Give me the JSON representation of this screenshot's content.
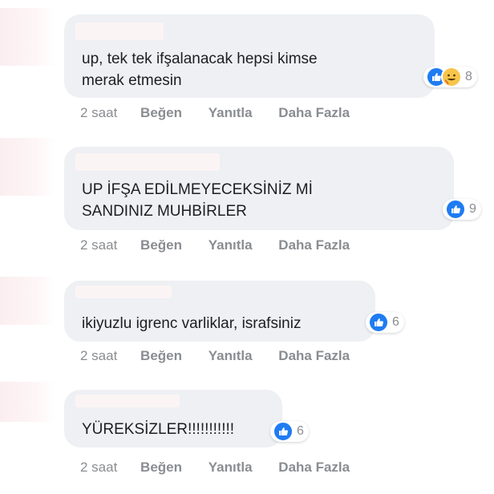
{
  "comments": [
    {
      "text_lines": [
        "up, tek tek ifşalanacak hepsi kimse",
        "merak etmesin"
      ],
      "reactions": [
        "like-icon",
        "haha-icon"
      ],
      "reaction_count": "8",
      "time": "2 saat",
      "like_label": "Beğen",
      "reply_label": "Yanıtla",
      "more_label": "Daha Fazla"
    },
    {
      "text_lines": [
        "UP İFŞA EDİLMEYECEKSİNİZ Mİ",
        "SANDINIZ MUHBİRLER"
      ],
      "reactions": [
        "like-icon"
      ],
      "reaction_count": "9",
      "time": "2 saat",
      "like_label": "Beğen",
      "reply_label": "Yanıtla",
      "more_label": "Daha Fazla"
    },
    {
      "text_lines": [
        "ikiyuzlu igrenc varliklar, israfsiniz"
      ],
      "reactions": [
        "like-icon"
      ],
      "reaction_count": "6",
      "time": "2 saat",
      "like_label": "Beğen",
      "reply_label": "Yanıtla",
      "more_label": "Daha Fazla"
    },
    {
      "text_lines": [
        "YÜREKSİZLER!!!!!!!!!!!"
      ],
      "reactions": [
        "like-icon"
      ],
      "reaction_count": "6",
      "time": "2 saat",
      "like_label": "Beğen",
      "reply_label": "Yanıtla",
      "more_label": "Daha Fazla"
    }
  ],
  "colors": {
    "bubble": "#eef0f3",
    "like_blue": "#1f7cf2",
    "meta_gray": "#8a8d91"
  }
}
